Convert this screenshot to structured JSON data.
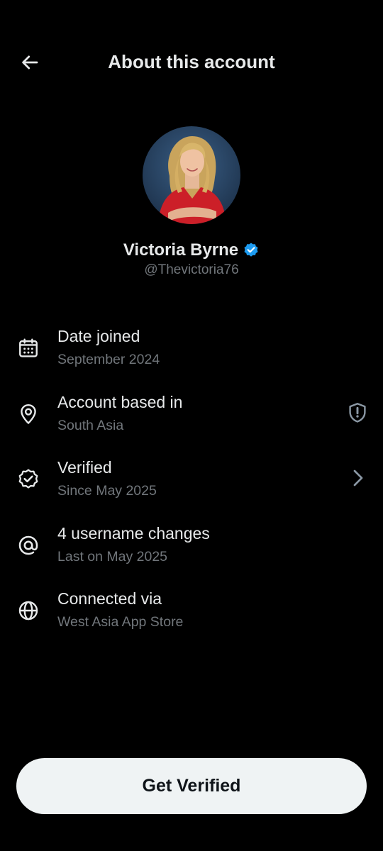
{
  "header": {
    "title": "About this account",
    "back_icon": "arrow-left-icon"
  },
  "profile": {
    "display_name": "Victoria Byrne",
    "handle": "@Thevictoria76",
    "verified_badge_color": "#1d9bf0"
  },
  "info_items": [
    {
      "icon": "calendar-icon",
      "title": "Date joined",
      "subtitle": "September 2024"
    },
    {
      "icon": "location-pin-icon",
      "title": "Account based in",
      "subtitle": "South Asia",
      "trailing_icon": "shield-alert-icon"
    },
    {
      "icon": "verified-badge-outline-icon",
      "title": "Verified",
      "subtitle": "Since May 2025",
      "trailing_icon": "chevron-right-icon"
    },
    {
      "icon": "at-sign-icon",
      "title": "4 username changes",
      "subtitle": "Last on May 2025"
    },
    {
      "icon": "globe-icon",
      "title": "Connected via",
      "subtitle": "West Asia App Store"
    }
  ],
  "cta": {
    "label": "Get Verified"
  },
  "colors": {
    "background": "#000000",
    "primary_text": "#e7e9ea",
    "secondary_text": "#71767b",
    "button_bg": "#eff3f4",
    "button_text": "#0f1419"
  }
}
